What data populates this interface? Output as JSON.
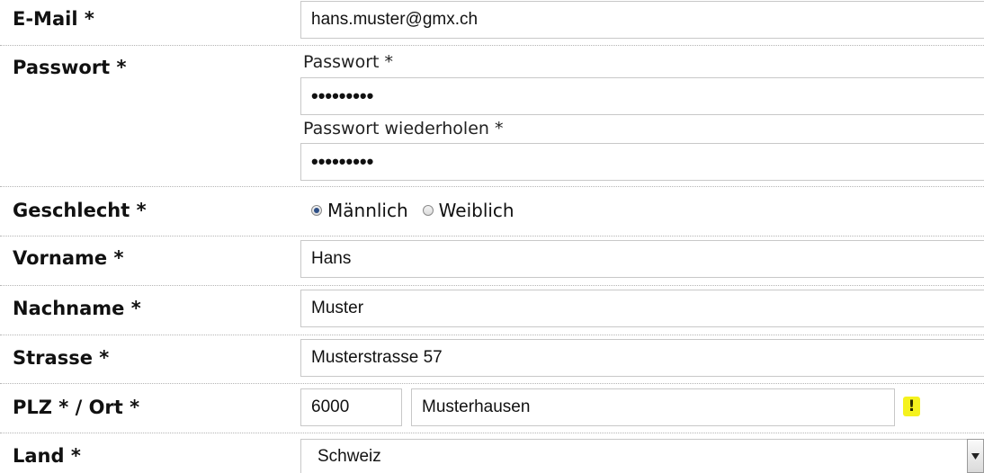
{
  "form": {
    "email": {
      "label": "E-Mail *",
      "value": "hans.muster@gmx.ch"
    },
    "password": {
      "label": "Passwort *",
      "field1_label": "Passwort *",
      "field1_value": "•••••••••",
      "field2_label": "Passwort wiederholen *",
      "field2_value": "•••••••••"
    },
    "gender": {
      "label": "Geschlecht *",
      "options": [
        "Männlich",
        "Weiblich"
      ],
      "selected": "Männlich"
    },
    "firstname": {
      "label": "Vorname *",
      "value": "Hans"
    },
    "lastname": {
      "label": "Nachname *",
      "value": "Muster"
    },
    "street": {
      "label": "Strasse *",
      "value": "Musterstrasse 57"
    },
    "zip_city": {
      "label": "PLZ * / Ort *",
      "zip": "6000",
      "city": "Musterhausen",
      "warning_icon": "exclamation-icon",
      "warning_glyph": "!"
    },
    "country": {
      "label": "Land *",
      "value": "Schweiz",
      "dropdown_icon": "chevron-down-icon"
    }
  },
  "colors": {
    "warning": "#f5f21e",
    "radio_selected": "#2d4f86"
  }
}
